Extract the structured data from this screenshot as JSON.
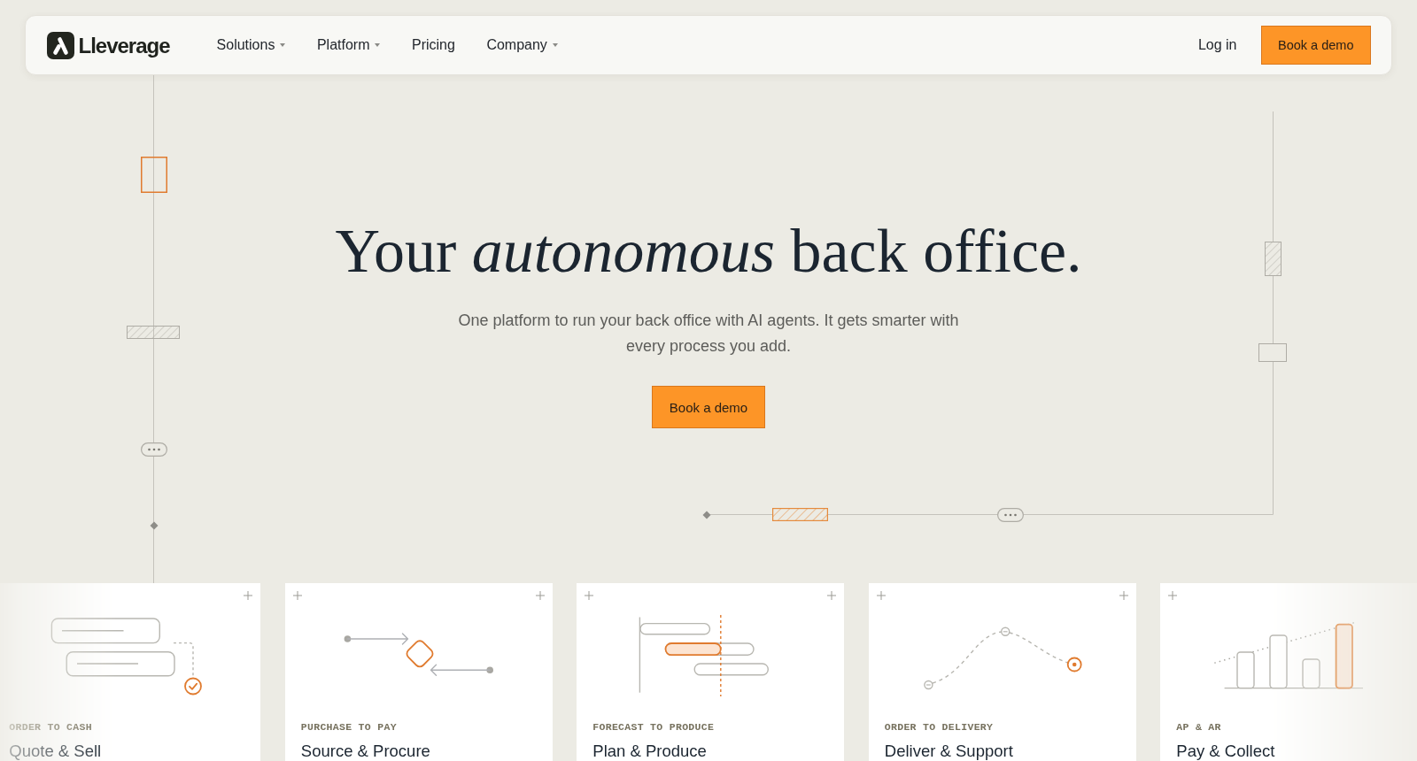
{
  "nav": {
    "logo": "Lleverage",
    "links": [
      {
        "label": "Solutions",
        "dropdown": true
      },
      {
        "label": "Platform",
        "dropdown": true
      },
      {
        "label": "Pricing",
        "dropdown": false
      },
      {
        "label": "Company",
        "dropdown": true
      }
    ],
    "login": "Log in",
    "cta": "Book a demo"
  },
  "hero": {
    "title": "Your *autonomous* back office.",
    "subtitle": "One platform to run your back office with AI agents. It gets smarter with every process you add.",
    "cta": "Book a demo"
  },
  "cards": [
    {
      "kind": "tasks",
      "eyebrow": "ORDER TO CASH",
      "title": "Quote & Sell",
      "plus_left": false,
      "plus_right": true
    },
    {
      "kind": "flow",
      "eyebrow": "PURCHASE TO PAY",
      "title": "Source & Procure",
      "plus_left": true,
      "plus_right": true
    },
    {
      "kind": "timeline",
      "eyebrow": "FORECAST TO PRODUCE",
      "title": "Plan & Produce",
      "plus_left": true,
      "plus_right": true
    },
    {
      "kind": "route",
      "eyebrow": "ORDER TO DELIVERY",
      "title": "Deliver & Support",
      "plus_left": true,
      "plus_right": true
    },
    {
      "kind": "bars",
      "eyebrow": "AP & AR",
      "title": "Pay & Collect",
      "plus_left": true,
      "plus_right": false
    }
  ]
}
